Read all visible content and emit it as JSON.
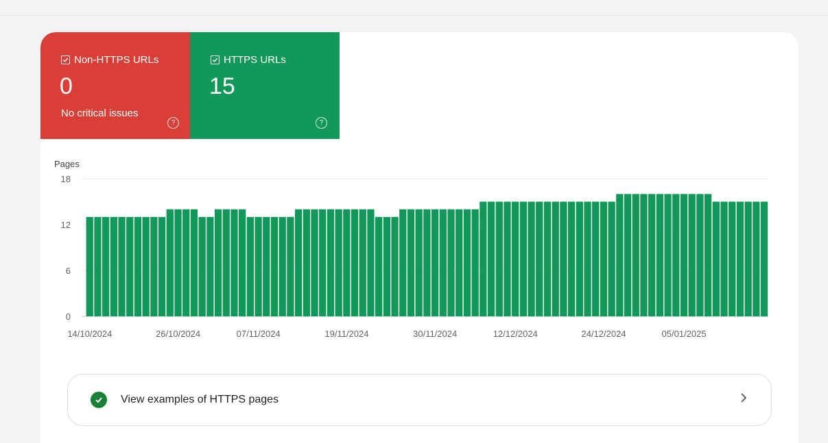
{
  "tiles": [
    {
      "label": "Non-HTTPS URLs",
      "value": "0",
      "subtitle": "No critical issues",
      "color": "#d93f36"
    },
    {
      "label": "HTTPS URLs",
      "value": "15",
      "subtitle": "",
      "color": "#12995a"
    }
  ],
  "icons": {
    "checkbox": "checkbox-checked-icon",
    "help": "help-circle-icon",
    "check": "check-circle-icon",
    "chevron": "chevron-right-icon"
  },
  "examples_link": {
    "label": "View examples of HTTPS pages"
  },
  "chart_data": {
    "type": "bar",
    "ylabel": "Pages",
    "ylim": [
      0,
      18
    ],
    "yticks": [
      0,
      6,
      12,
      18
    ],
    "xtick_labels": [
      "14/10/2024",
      "26/10/2024",
      "07/11/2024",
      "19/11/2024",
      "30/11/2024",
      "12/12/2024",
      "24/12/2024",
      "05/01/2025"
    ],
    "bar_color": "#12995a",
    "grid": true,
    "series": [
      {
        "values": [
          13,
          13,
          13,
          13,
          13,
          13,
          13,
          13,
          13,
          13,
          14,
          14,
          14,
          14,
          13,
          13,
          14,
          14,
          14,
          14,
          13,
          13,
          13,
          13,
          13,
          13,
          14,
          14,
          14,
          14,
          14,
          14,
          14,
          14,
          14,
          14,
          13,
          13,
          13,
          14,
          14,
          14,
          14,
          14,
          14,
          14,
          14,
          14,
          14,
          15,
          15,
          15,
          15,
          15,
          15,
          15,
          15,
          15,
          15,
          15,
          15,
          15,
          15,
          15,
          15,
          15,
          16,
          16,
          16,
          16,
          16,
          16,
          16,
          16,
          16,
          16,
          16,
          16,
          15,
          15,
          15,
          15,
          15,
          15,
          15
        ]
      }
    ]
  }
}
